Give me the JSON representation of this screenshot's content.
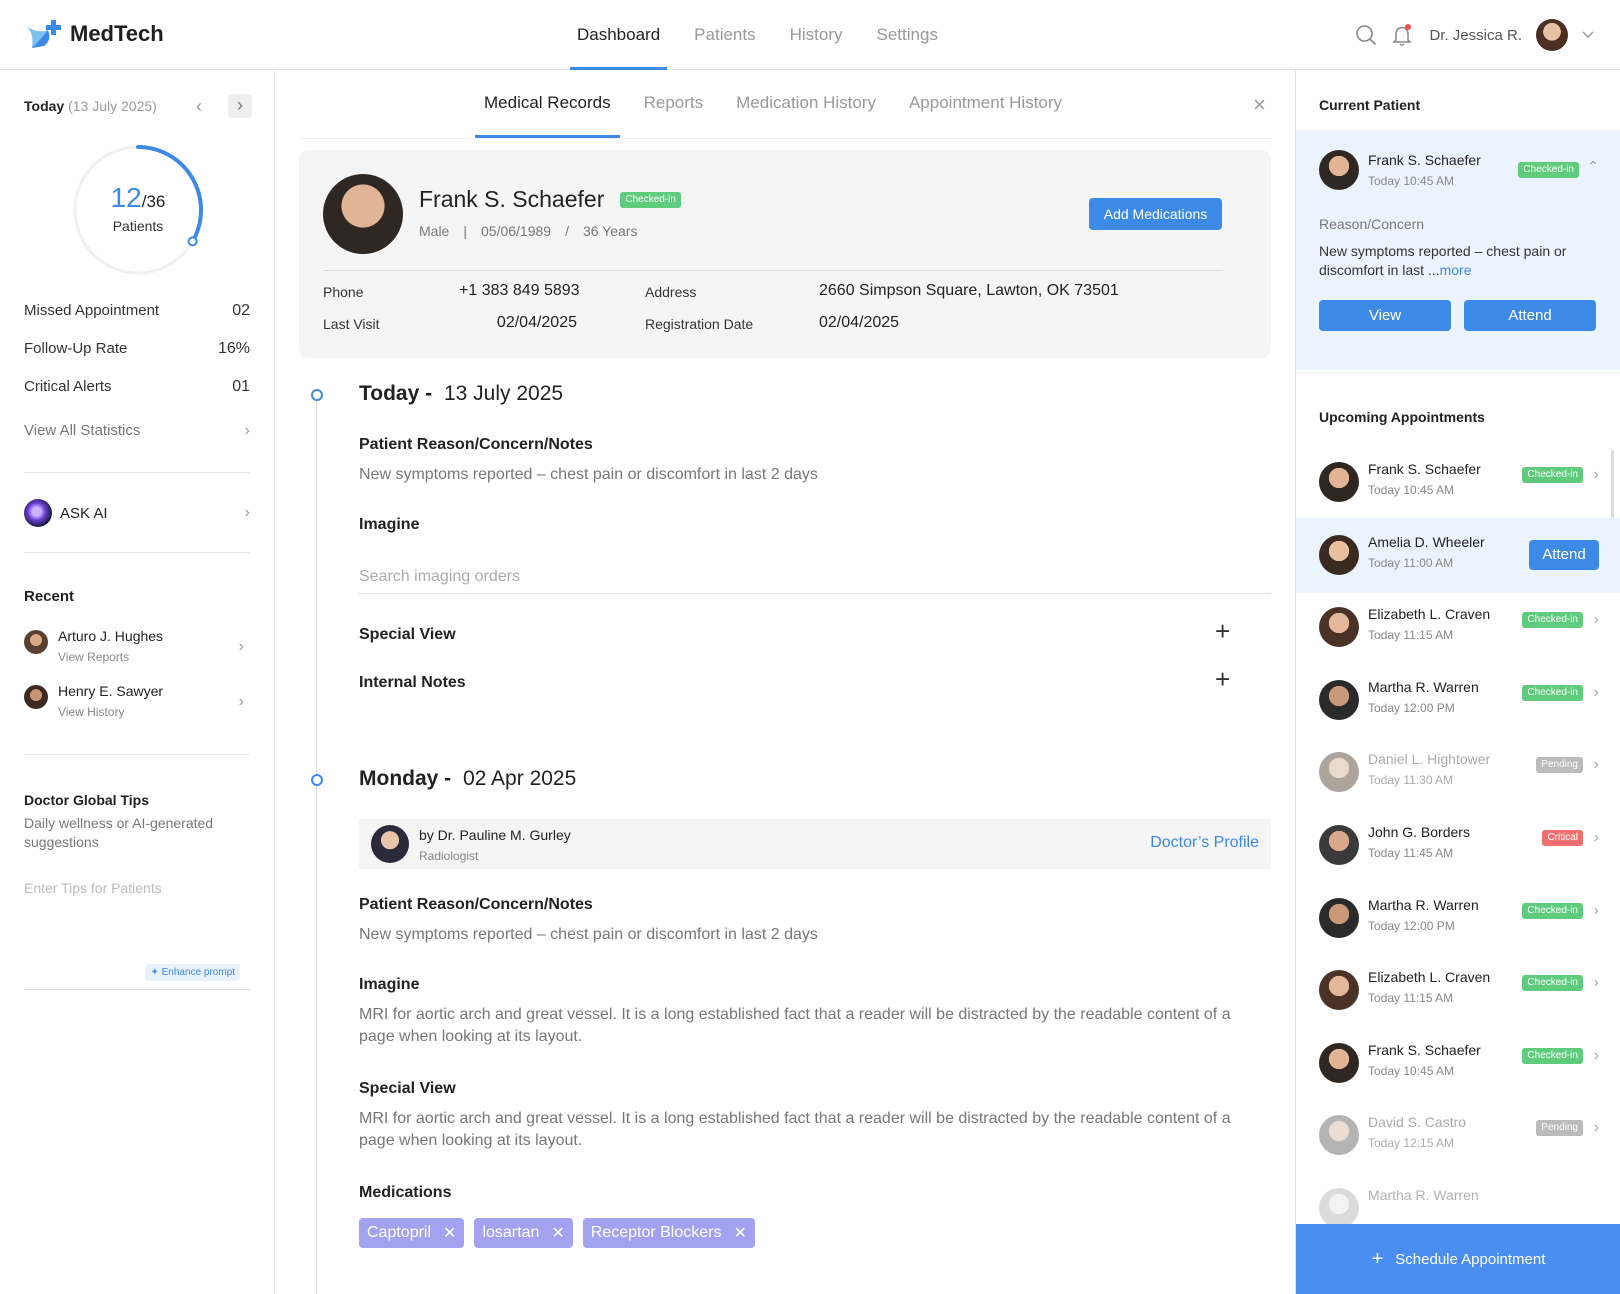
{
  "app": {
    "name": "MedTech"
  },
  "nav": {
    "items": [
      "Dashboard",
      "Patients",
      "History",
      "Settings"
    ],
    "active": 0
  },
  "user": {
    "name": "Dr. Jessica R."
  },
  "left": {
    "today_label": "Today",
    "today_date": "(13 July 2025)",
    "progress": {
      "value": "12",
      "total": "/36",
      "label": "Patients",
      "fraction": 0.333
    },
    "stats": [
      {
        "label": "Missed Appointment",
        "value": "02"
      },
      {
        "label": "Follow-Up Rate",
        "value": "16%"
      },
      {
        "label": "Critical Alerts",
        "value": "01"
      }
    ],
    "view_all": "View All Statistics",
    "ask_ai": "ASK AI",
    "recent_title": "Recent",
    "recent": [
      {
        "name": "Arturo J. Hughes",
        "sub": "View Reports"
      },
      {
        "name": "Henry E. Sawyer",
        "sub": "View History"
      }
    ],
    "tips_title": "Doctor Global Tips",
    "tips_desc": "Daily wellness or AI-generated suggestions",
    "tips_placeholder": "Enter Tips for Patients",
    "enhance": "Enhance prompt"
  },
  "center": {
    "tabs": [
      "Medical Records",
      "Reports",
      "Medication History",
      "Appointment History"
    ],
    "active_tab": 0,
    "patient": {
      "name": "Frank S. Schaefer",
      "status": "Checked-in",
      "gender": "Male",
      "sep1": "|",
      "dob": "05/06/1989",
      "sep2": "/",
      "age": "36 Years",
      "add_btn": "Add Medications",
      "phone_label": "Phone",
      "phone": "+1 383 849 5893",
      "address_label": "Address",
      "address": "2660 Simpson Square, Lawton, OK 73501",
      "last_visit_label": "Last Visit",
      "last_visit": "02/04/2025",
      "reg_label": "Registration Date",
      "reg_date": "02/04/2025"
    },
    "today": {
      "day": "Today -",
      "date": "13 July 2025",
      "reason_title": "Patient Reason/Concern/Notes",
      "reason": "New symptoms reported – chest pain or discomfort in last 2 days",
      "imagine_title": "Imagine",
      "search_placeholder": "Search imaging orders",
      "special_title": "Special View",
      "notes_title": "Internal Notes"
    },
    "past": {
      "day": "Monday -",
      "date": "02 Apr 2025",
      "doctor": "by Dr. Pauline M. Gurley",
      "role": "Radiologist",
      "profile_link": "Doctor’s Profile",
      "reason_title": "Patient Reason/Concern/Notes",
      "reason": "New symptoms reported – chest pain or discomfort in last 2 days",
      "imagine_title": "Imagine",
      "imagine": "MRI for aortic arch and great vessel. It is a long established fact that a reader will be distracted by the readable content of a page when looking at its layout.",
      "special_title": "Special View",
      "special": "MRI for aortic arch and great vessel. It is a long established fact that a reader will be distracted by the readable content of a page when looking at its layout.",
      "meds_title": "Medications",
      "meds": [
        "Captopril",
        "losartan",
        "Receptor Blockers"
      ]
    }
  },
  "right": {
    "current_title": "Current Patient",
    "current": {
      "name": "Frank S. Schaefer",
      "time": "Today 10:45 AM",
      "status": "Checked-in",
      "reason_label": "Reason/Concern",
      "reason": "New symptoms reported – chest pain or discomfort in last ...",
      "more": "more",
      "view": "View",
      "attend": "Attend"
    },
    "upcoming_title": "Upcoming Appointments",
    "attend_label": "Attend",
    "upcoming": [
      {
        "name": "Frank S. Schaefer",
        "time": "Today 10:45 AM",
        "status": "Checked-in"
      },
      {
        "name": "Amelia D. Wheeler",
        "time": "Today 11:00 AM",
        "status": "Attend"
      },
      {
        "name": "Elizabeth L. Craven",
        "time": "Today 11:15 AM",
        "status": "Checked-in"
      },
      {
        "name": "Martha R. Warren",
        "time": "Today 12:00 PM",
        "status": "Checked-in"
      },
      {
        "name": "Daniel L. Hightower",
        "time": "Today 11:30 AM",
        "status": "Pending"
      },
      {
        "name": "John G. Borders",
        "time": "Today 11:45 AM",
        "status": "Critical"
      },
      {
        "name": "Martha R. Warren",
        "time": "Today 12:00 PM",
        "status": "Checked-in"
      },
      {
        "name": "Elizabeth L. Craven",
        "time": "Today 11:15 AM",
        "status": "Checked-in"
      },
      {
        "name": "Frank S. Schaefer",
        "time": "Today 10:45 AM",
        "status": "Checked-in"
      },
      {
        "name": "David S. Castro",
        "time": "Today 12:15 AM",
        "status": "Pending"
      },
      {
        "name": "Martha R. Warren",
        "time": "",
        "status": ""
      }
    ],
    "schedule": "Schedule Appointment"
  },
  "colors": {
    "accent": "#3d8ae6",
    "checked": "#5fcb7c",
    "pending": "#bbbbbb",
    "critical": "#f07070",
    "pill": "#a3a2f0"
  }
}
